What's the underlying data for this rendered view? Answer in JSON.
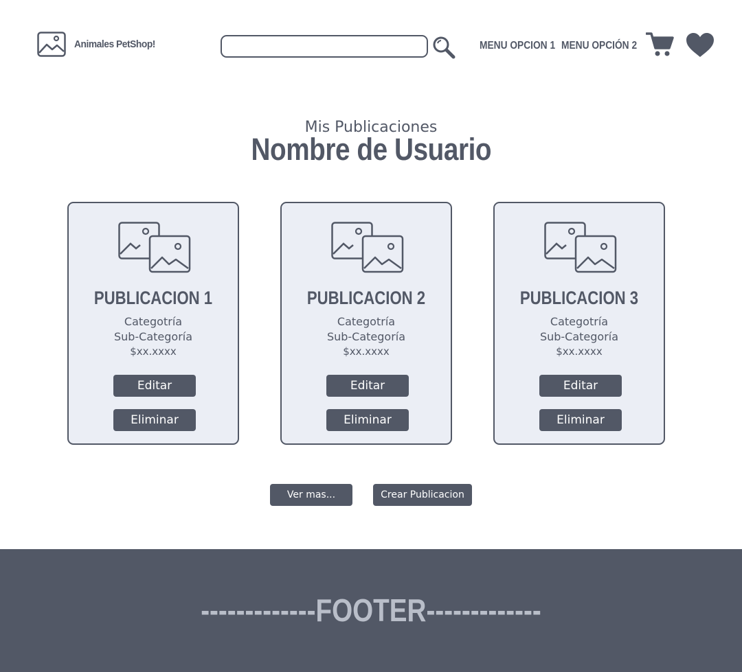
{
  "header": {
    "brand": "Animales PetShop!",
    "search": {
      "value": "",
      "placeholder": ""
    },
    "menu": [
      {
        "label": "MENU OPCION 1"
      },
      {
        "label": "MENU OPCIÓN 2"
      }
    ],
    "icons": [
      "image-icon",
      "search-icon",
      "cart-icon",
      "heart-icon"
    ]
  },
  "main": {
    "subtitle": "Mis Publicaciones",
    "title": "Nombre de Usuario",
    "cards": [
      {
        "title": "PUBLICACION 1",
        "category": "Categotría",
        "subcategory": "Sub-Categoría",
        "price": "$xx.xxxx",
        "edit_label": "Editar",
        "delete_label": "Eliminar"
      },
      {
        "title": "PUBLICACION 2",
        "category": "Categotría",
        "subcategory": "Sub-Categoría",
        "price": "$xx.xxxx",
        "edit_label": "Editar",
        "delete_label": "Eliminar"
      },
      {
        "title": "PUBLICACION 3",
        "category": "Categotría",
        "subcategory": "Sub-Categoría",
        "price": "$xx.xxxx",
        "edit_label": "Editar",
        "delete_label": "Eliminar"
      }
    ],
    "actions": {
      "see_more": "Ver mas...",
      "create": "Crear Publicacion"
    }
  },
  "footer": {
    "text": "-------------FOOTER-------------"
  },
  "colors": {
    "primary": "#525866",
    "card_background": "#ebeef5",
    "footer_text": "#b9bec9",
    "background": "#ffffff"
  }
}
